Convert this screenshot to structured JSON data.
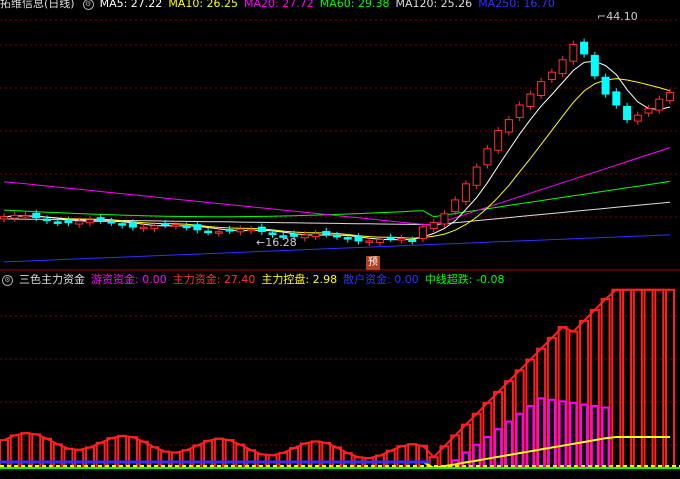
{
  "top_panel": {
    "title": "拓维信息(日线)",
    "indicators": [
      {
        "label": "MA5: 27.22",
        "color": "#ffffff"
      },
      {
        "label": "MA10: 26.25",
        "color": "#ffff00"
      },
      {
        "label": "MA20: 27.72",
        "color": "#ff00ff"
      },
      {
        "label": "MA60: 29.38",
        "color": "#00ff00"
      },
      {
        "label": "MA120: 25.26",
        "color": "#dddddd"
      },
      {
        "label": "MA250: 16.70",
        "color": "#3030ff"
      }
    ],
    "high_label": "44.10",
    "low_label": "16.28",
    "forecast_badge": "预"
  },
  "bottom_panel": {
    "title": "三色主力资金",
    "indicators": [
      {
        "label": "游资资金: 0.00",
        "color": "#ff00ff"
      },
      {
        "label": "主力资金: 27.40",
        "color": "#ff3030"
      },
      {
        "label": "主力控盘: 2.98",
        "color": "#ffff00"
      },
      {
        "label": "散户资金: 0.00",
        "color": "#3030ff"
      },
      {
        "label": "中线超跌: -0.08",
        "color": "#00ff00"
      }
    ]
  },
  "colors": {
    "up": "#ff3030",
    "down": "#00ffff",
    "background": "#000000",
    "grid": "#800000"
  }
}
